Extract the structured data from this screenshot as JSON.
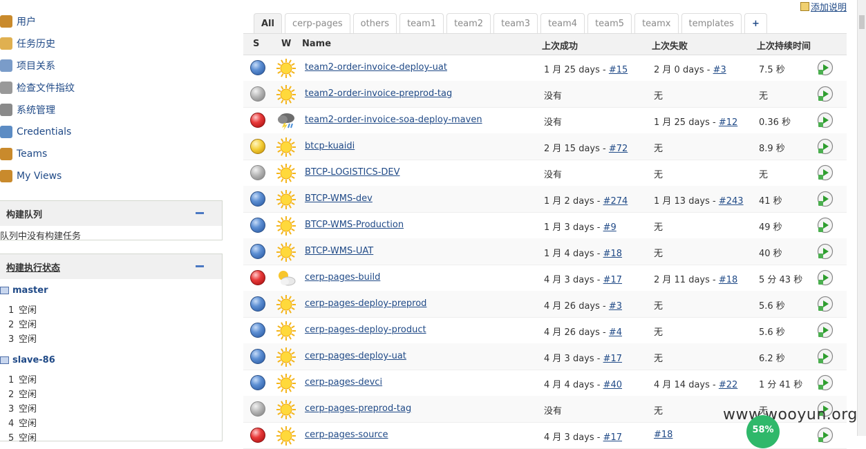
{
  "sidebar": {
    "menu": [
      {
        "label": "用户",
        "icon": "users-icon"
      },
      {
        "label": "任务历史",
        "icon": "notepad-icon"
      },
      {
        "label": "项目关系",
        "icon": "magnifier-icon"
      },
      {
        "label": "检查文件指纹",
        "icon": "fingerprint-icon"
      },
      {
        "label": "系统管理",
        "icon": "tools-icon"
      },
      {
        "label": "Credentials",
        "icon": "credentials-icon"
      },
      {
        "label": "Teams",
        "icon": "users-icon"
      },
      {
        "label": "My Views",
        "icon": "users-icon"
      }
    ],
    "build_queue": {
      "title": "构建队列",
      "empty_text": "队列中没有构建任务"
    },
    "executor_status": {
      "title": "构建执行状态",
      "nodes": [
        {
          "name": "master",
          "executors": [
            {
              "num": "1",
              "state": "空闲"
            },
            {
              "num": "2",
              "state": "空闲"
            },
            {
              "num": "3",
              "state": "空闲"
            }
          ]
        },
        {
          "name": "slave-86",
          "executors": [
            {
              "num": "1",
              "state": "空闲"
            },
            {
              "num": "2",
              "state": "空闲"
            },
            {
              "num": "3",
              "state": "空闲"
            },
            {
              "num": "4",
              "state": "空闲"
            },
            {
              "num": "5",
              "state": "空闲"
            }
          ]
        }
      ]
    }
  },
  "add_description": "添加说明",
  "tabs": [
    "All",
    "cerp-pages",
    "others",
    "team1",
    "team2",
    "team3",
    "team4",
    "team5",
    "teamx",
    "templates",
    "+"
  ],
  "table": {
    "headers": {
      "s": "S",
      "w": "W",
      "name": "Name",
      "last_success": "上次成功",
      "last_failure": "上次失败",
      "last_duration": "上次持续时间"
    },
    "rows": [
      {
        "status": "blue",
        "weather": "sunny",
        "name": "team2-order-invoice-deploy-uat",
        "succ": "1 月 25 days - ",
        "succ_link": "#15",
        "fail": "2 月 0 days - ",
        "fail_link": "#3",
        "dur": "7.5 秒"
      },
      {
        "status": "grey",
        "weather": "sunny",
        "name": "team2-order-invoice-preprod-tag",
        "succ": "没有",
        "succ_link": "",
        "fail": "无",
        "fail_link": "",
        "dur": "无"
      },
      {
        "status": "red",
        "weather": "storm",
        "name": "team2-order-invoice-soa-deploy-maven",
        "succ": "没有",
        "succ_link": "",
        "fail": "1 月 25 days - ",
        "fail_link": "#12",
        "dur": "0.36 秒"
      },
      {
        "status": "yellow",
        "weather": "sunny",
        "name": "btcp-kuaidi",
        "succ": "2 月 15 days - ",
        "succ_link": "#72",
        "fail": "无",
        "fail_link": "",
        "dur": "8.9 秒"
      },
      {
        "status": "grey",
        "weather": "sunny",
        "name": "BTCP-LOGISTICS-DEV",
        "succ": "没有",
        "succ_link": "",
        "fail": "无",
        "fail_link": "",
        "dur": "无"
      },
      {
        "status": "blue",
        "weather": "sunny",
        "name": "BTCP-WMS-dev",
        "succ": "1 月 2 days - ",
        "succ_link": "#274",
        "fail": "1 月 13 days - ",
        "fail_link": "#243",
        "dur": "41 秒"
      },
      {
        "status": "blue",
        "weather": "sunny",
        "name": "BTCP-WMS-Production",
        "succ": "1 月 3 days - ",
        "succ_link": "#9",
        "fail": "无",
        "fail_link": "",
        "dur": "49 秒"
      },
      {
        "status": "blue",
        "weather": "sunny",
        "name": "BTCP-WMS-UAT",
        "succ": "1 月 4 days - ",
        "succ_link": "#18",
        "fail": "无",
        "fail_link": "",
        "dur": "40 秒"
      },
      {
        "status": "red",
        "weather": "partly-cloudy",
        "name": "cerp-pages-build",
        "succ": "4 月 3 days - ",
        "succ_link": "#17",
        "fail": "2 月 11 days - ",
        "fail_link": "#18",
        "dur": "5 分 43 秒"
      },
      {
        "status": "blue",
        "weather": "sunny",
        "name": "cerp-pages-deploy-preprod",
        "succ": "4 月 26 days - ",
        "succ_link": "#3",
        "fail": "无",
        "fail_link": "",
        "dur": "5.6 秒"
      },
      {
        "status": "blue",
        "weather": "sunny",
        "name": "cerp-pages-deploy-product",
        "succ": "4 月 26 days - ",
        "succ_link": "#4",
        "fail": "无",
        "fail_link": "",
        "dur": "5.6 秒"
      },
      {
        "status": "blue",
        "weather": "sunny",
        "name": "cerp-pages-deploy-uat",
        "succ": "4 月 3 days - ",
        "succ_link": "#17",
        "fail": "无",
        "fail_link": "",
        "dur": "6.2 秒"
      },
      {
        "status": "blue",
        "weather": "sunny",
        "name": "cerp-pages-devci",
        "succ": "4 月 4 days - ",
        "succ_link": "#40",
        "fail": "4 月 14 days - ",
        "fail_link": "#22",
        "dur": "1 分 41 秒"
      },
      {
        "status": "grey",
        "weather": "sunny",
        "name": "cerp-pages-preprod-tag",
        "succ": "没有",
        "succ_link": "",
        "fail": "无",
        "fail_link": "",
        "dur": "无"
      },
      {
        "status": "red",
        "weather": "sunny",
        "name": "cerp-pages-source",
        "succ": "4 月 3 days - ",
        "succ_link": "#17",
        "fail": "",
        "fail_link": "#18",
        "dur": ""
      }
    ]
  },
  "overlay": {
    "watermark": "www.wooyun.org",
    "cpu_percent": "58%"
  }
}
